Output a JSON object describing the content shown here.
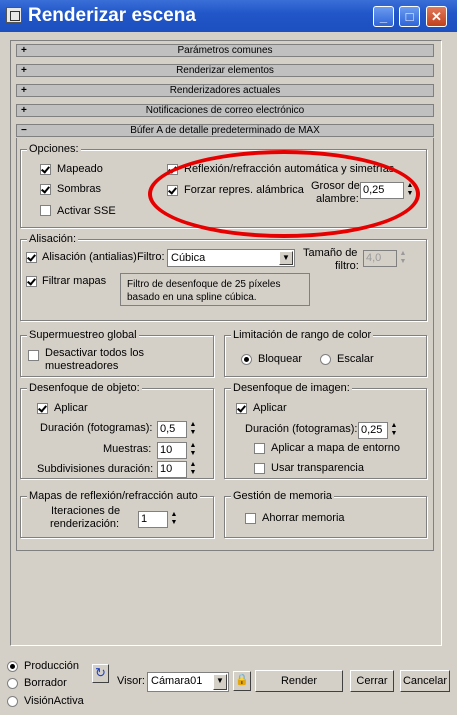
{
  "window": {
    "title": "Renderizar escena",
    "min": "_",
    "max": "□",
    "close": "✕"
  },
  "rollouts": [
    {
      "sign": "+",
      "label": "Parámetros comunes"
    },
    {
      "sign": "+",
      "label": "Renderizar elementos"
    },
    {
      "sign": "+",
      "label": "Renderizadores actuales"
    },
    {
      "sign": "+",
      "label": "Notificaciones de correo electrónico"
    },
    {
      "sign": "−",
      "label": "Búfer A de detalle predeterminado de MAX"
    }
  ],
  "opciones": {
    "title": "Opciones:",
    "mapeado": {
      "label": "Mapeado",
      "checked": true
    },
    "sombras": {
      "label": "Sombras",
      "checked": true
    },
    "activar_sse": {
      "label": "Activar SSE",
      "checked": false
    },
    "reflexion": {
      "label": "Reflexión/refracción automática y simetrías",
      "checked": true
    },
    "forzar": {
      "label": "Forzar repres. alámbrica",
      "checked": true
    },
    "grosor_label_1": "Grosor de",
    "grosor_label_2": "alambre:",
    "grosor_value": "0,25"
  },
  "alisacion": {
    "title": "Alisación:",
    "alisacion_cb": {
      "label": "Alisación (antialias)",
      "checked": true
    },
    "filtro_label": "Filtro:",
    "filtro_value": "Cúbica",
    "tamano_label_1": "Tamaño de",
    "tamano_label_2": "filtro:",
    "tamano_value": "4,0",
    "filtrar_mapas": {
      "label": "Filtrar mapas",
      "checked": true
    },
    "info_1": "Filtro de desenfoque de 25 píxeles",
    "info_2": "basado en una spline cúbica."
  },
  "supermuestreo": {
    "title": "Supermuestreo global",
    "desactivar_1": "Desactivar todos los",
    "desactivar_2": "muestreadores",
    "checked": false
  },
  "limitacion": {
    "title": "Limitación de rango de color",
    "bloquear": "Bloquear",
    "escalar": "Escalar",
    "selected": "bloquear"
  },
  "desenfoque_objeto": {
    "title": "Desenfoque de objeto:",
    "aplicar": {
      "label": "Aplicar",
      "checked": true
    },
    "duracion_label": "Duración (fotogramas):",
    "duracion_value": "0,5",
    "muestras_label": "Muestras:",
    "muestras_value": "10",
    "subdiv_label": "Subdivisiones duración:",
    "subdiv_value": "10"
  },
  "desenfoque_imagen": {
    "title": "Desenfoque de imagen:",
    "aplicar": {
      "label": "Aplicar",
      "checked": true
    },
    "duracion_label": "Duración (fotogramas):",
    "duracion_value": "0,25",
    "mapa_entorno": {
      "label": "Aplicar a mapa de entorno",
      "checked": false
    },
    "transparencia": {
      "label": "Usar transparencia",
      "checked": false
    }
  },
  "mapas_reflexion": {
    "title": "Mapas de reflexión/refracción auto",
    "iter_label_1": "Iteraciones de",
    "iter_label_2": "renderización:",
    "iter_value": "1"
  },
  "gestion_memoria": {
    "title": "Gestión de memoria",
    "ahorrar": {
      "label": "Ahorrar memoria",
      "checked": false
    }
  },
  "bottom": {
    "produccion": "Producción",
    "borrador": "Borrador",
    "vision_activa": "VisiónActiva",
    "selected": "produccion",
    "visor_label": "Visor:",
    "visor_value": "Cámara01",
    "render": "Render",
    "cerrar": "Cerrar",
    "cancelar": "Cancelar"
  },
  "colors": {
    "titlebar": "#2257c9",
    "dialog_bg": "#d4d0c8",
    "annotation": "#e60000"
  }
}
